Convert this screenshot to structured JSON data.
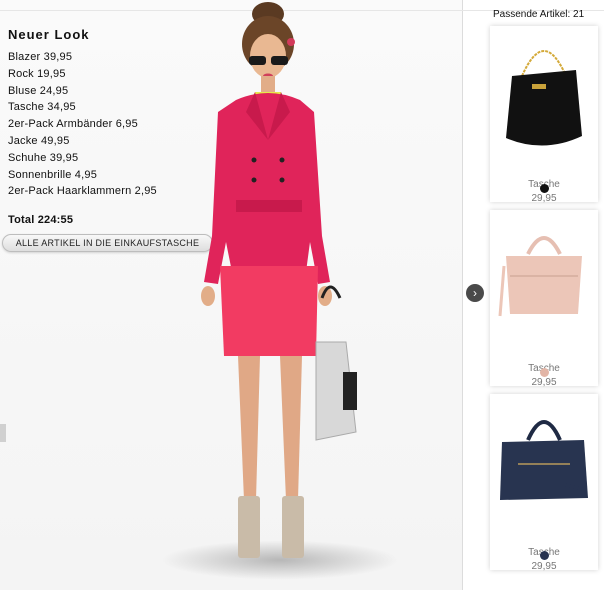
{
  "look": {
    "title": "Neuer Look",
    "items": [
      "Blazer 39,95",
      "Rock 19,95",
      "Bluse 24,95",
      "Tasche 34,95",
      "2er-Pack Armbänder 6,95",
      "Jacke 49,95",
      "Schuhe 39,95",
      "Sonnenbrille 4,95",
      "2er-Pack Haarklammern  2,95"
    ],
    "total": "Total 224:55",
    "add_all_label": "ALLE ARTIKEL IN DIE EINKAUFSTASCHE"
  },
  "panel": {
    "title": "Passende Artikel: 21",
    "next_icon": "chevron-right-icon",
    "products": [
      {
        "name": "Tasche",
        "price": "29,95",
        "color": "#111111",
        "image": "black-handbag"
      },
      {
        "name": "Tasche",
        "price": "29,95",
        "color": "#e2b5a6",
        "image": "pink-handbag"
      },
      {
        "name": "Tasche",
        "price": "29,95",
        "color": "#283450",
        "image": "navy-handbag"
      }
    ]
  },
  "colors": {
    "blazer": "#e0245a",
    "skirt": "#f23b62",
    "blouse": "#e6ea4a"
  }
}
